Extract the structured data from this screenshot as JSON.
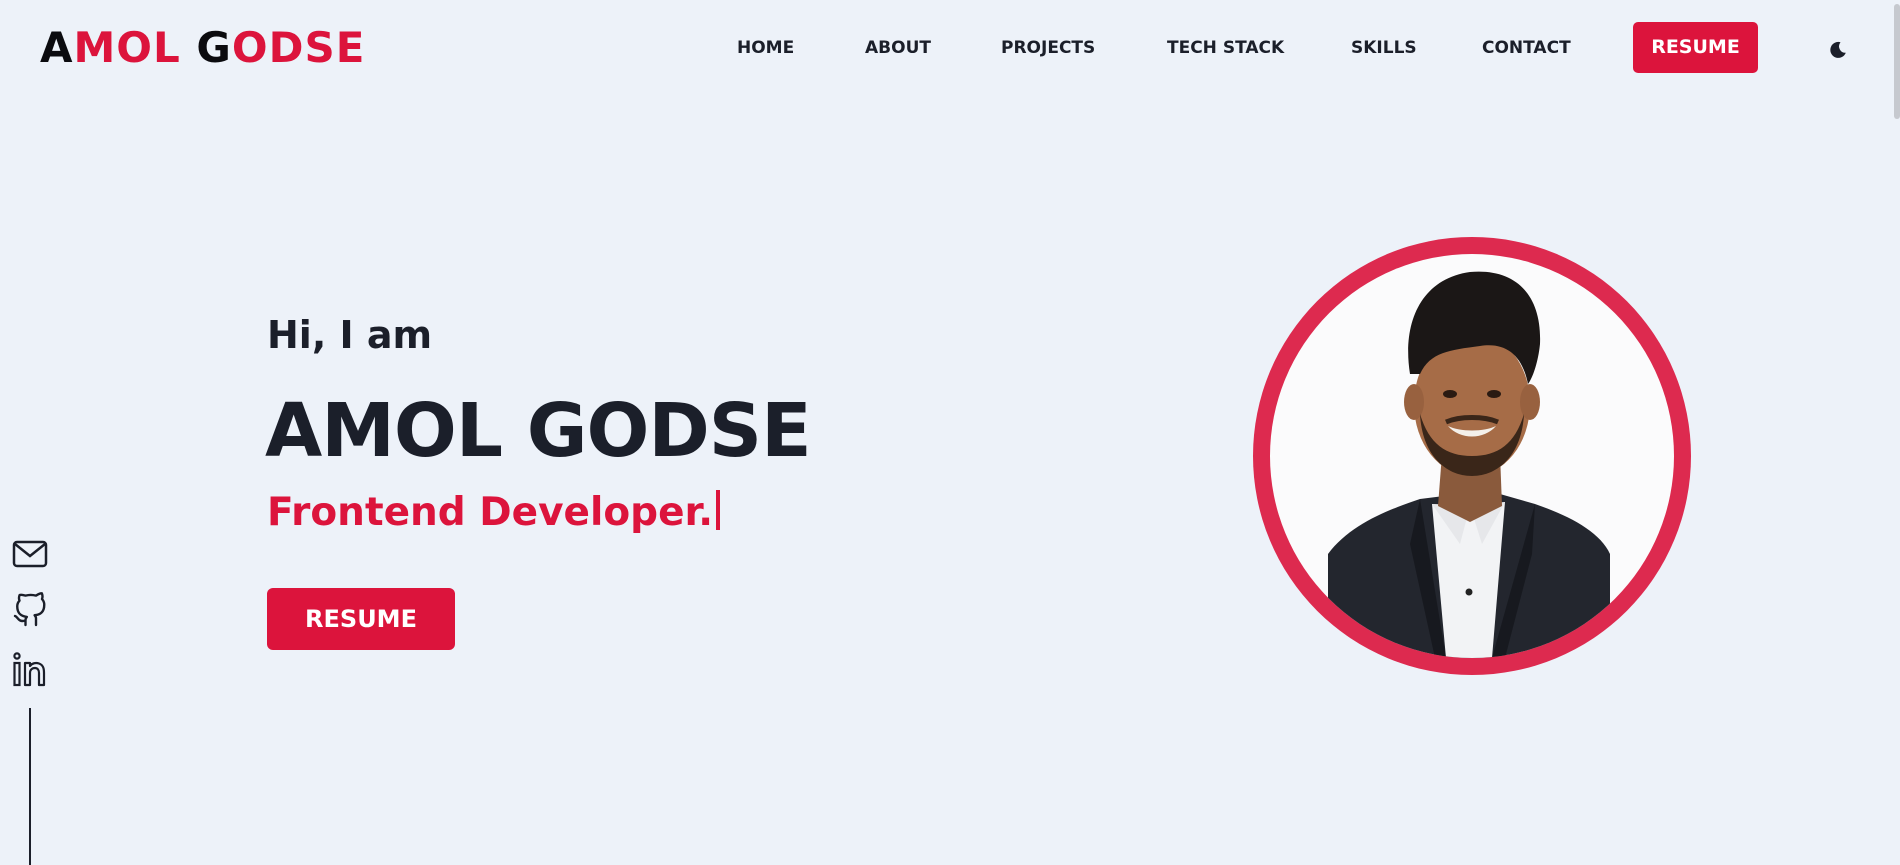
{
  "logo": {
    "letter1": "A",
    "part1": "MOL ",
    "letter2": "G",
    "part2": "ODSE"
  },
  "nav": {
    "items": [
      {
        "label": "HOME"
      },
      {
        "label": "ABOUT"
      },
      {
        "label": "PROJECTS"
      },
      {
        "label": "TECH STACK"
      },
      {
        "label": "SKILLS"
      },
      {
        "label": "CONTACT"
      }
    ],
    "resume_label": "RESUME",
    "theme_icon": "moon-icon"
  },
  "hero": {
    "greeting": "Hi, I am",
    "name": "AMOL GODSE",
    "role": "Frontend Developer.",
    "resume_label": "RESUME"
  },
  "social": {
    "icons": [
      "mail-icon",
      "github-icon",
      "linkedin-icon"
    ]
  },
  "colors": {
    "accent": "#dc143c",
    "background": "#edf2f9",
    "text": "#1b1f2a"
  }
}
